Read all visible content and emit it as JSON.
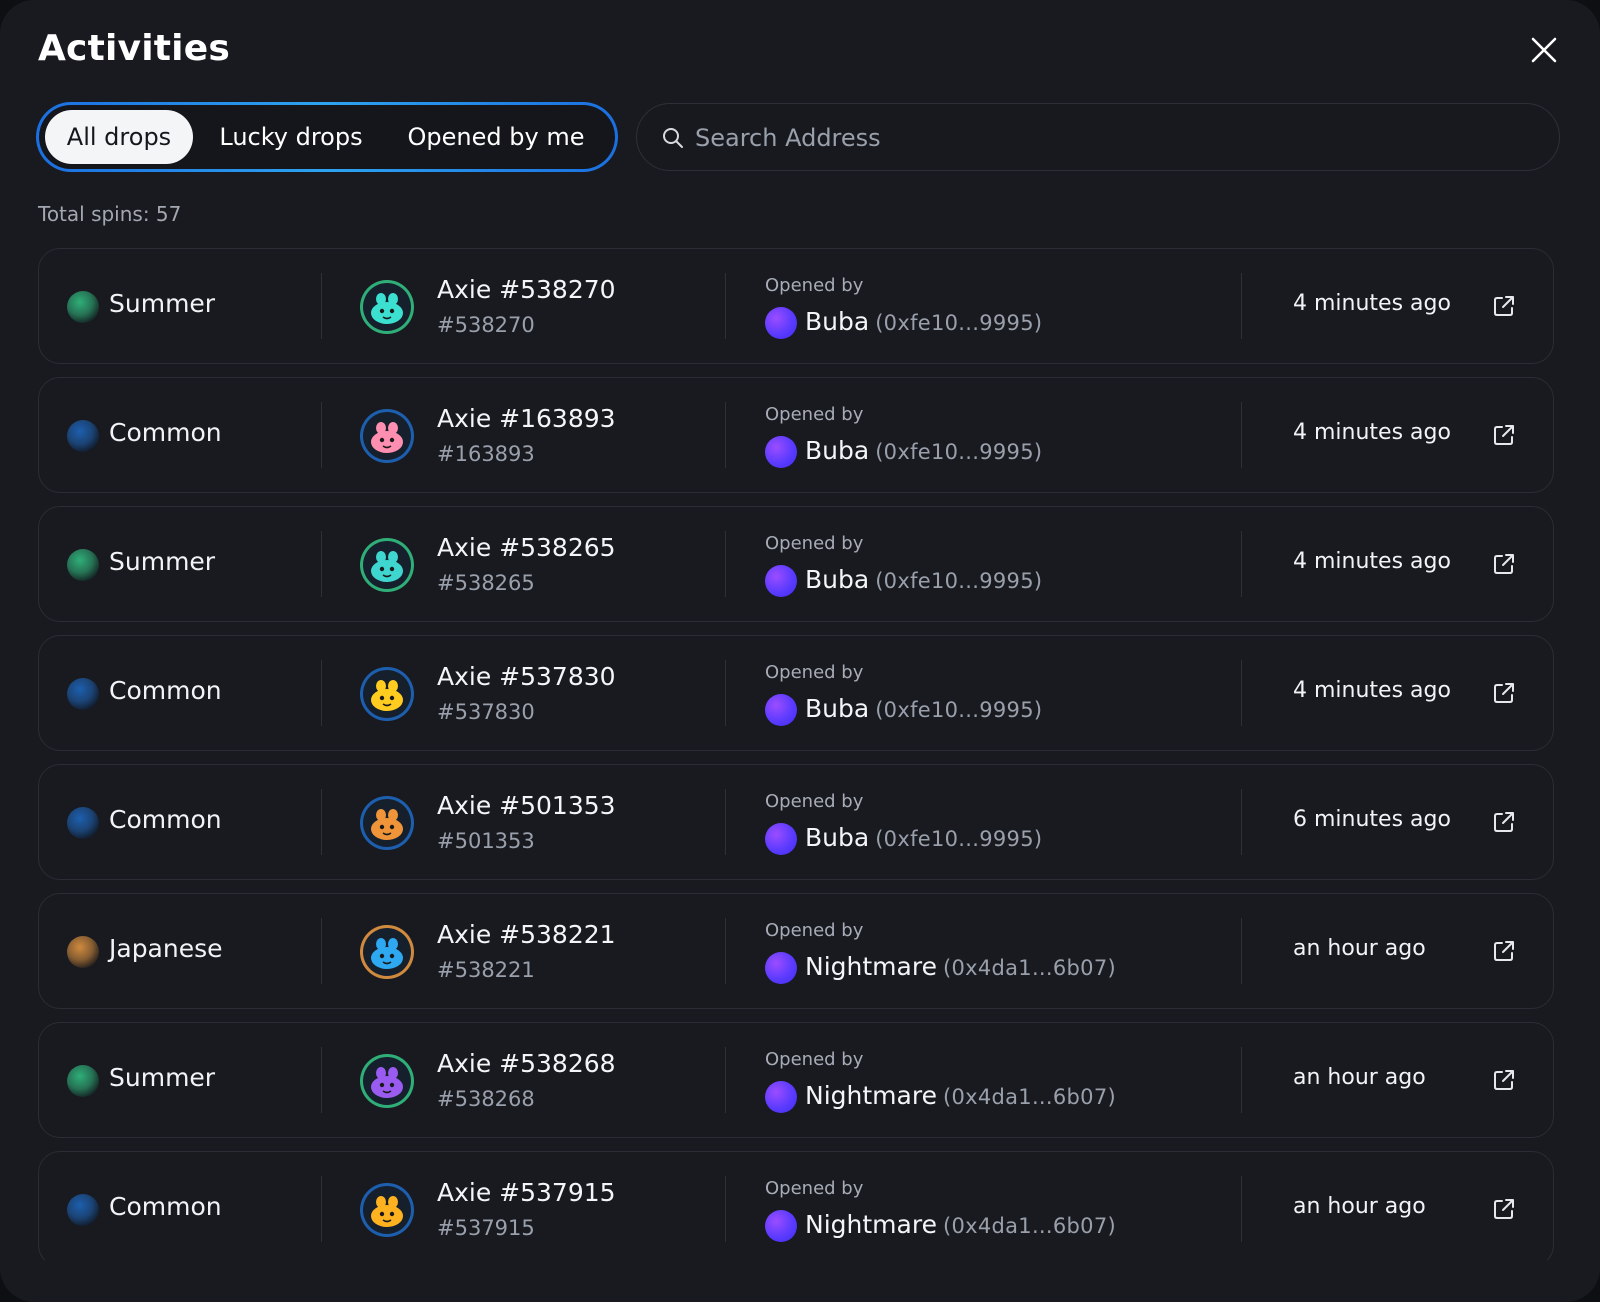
{
  "modal": {
    "title": "Activities",
    "tabs": [
      {
        "label": "All drops",
        "active": true
      },
      {
        "label": "Lucky drops",
        "active": false
      },
      {
        "label": "Opened by me",
        "active": false
      }
    ],
    "search_placeholder": "Search Address",
    "total_spins": "Total spins: 57",
    "opened_by_label": "Opened by"
  },
  "colors": {
    "summer": "#2fae78",
    "common": "#1d5fae",
    "japanese": "#d08a3e",
    "accent": "#2d8cf0",
    "user_avatar": "#6b3dff"
  },
  "rows": [
    {
      "tier": "Summer",
      "tier_color": "#2fae78",
      "axie": "Axie #538270",
      "id": "#538270",
      "user": "Buba",
      "addr": "(0xfe10...9995)",
      "time": "4 minutes ago",
      "axie_color": "#3ce0d0",
      "ring": "#2fae78"
    },
    {
      "tier": "Common",
      "tier_color": "#1d5fae",
      "axie": "Axie #163893",
      "id": "#163893",
      "user": "Buba",
      "addr": "(0xfe10...9995)",
      "time": "4 minutes ago",
      "axie_color": "#ff8fb0",
      "ring": "#1d5fae"
    },
    {
      "tier": "Summer",
      "tier_color": "#2fae78",
      "axie": "Axie #538265",
      "id": "#538265",
      "user": "Buba",
      "addr": "(0xfe10...9995)",
      "time": "4 minutes ago",
      "axie_color": "#3fd6d0",
      "ring": "#2fae78"
    },
    {
      "tier": "Common",
      "tier_color": "#1d5fae",
      "axie": "Axie #537830",
      "id": "#537830",
      "user": "Buba",
      "addr": "(0xfe10...9995)",
      "time": "4 minutes ago",
      "axie_color": "#ffcc1f",
      "ring": "#1d5fae"
    },
    {
      "tier": "Common",
      "tier_color": "#1d5fae",
      "axie": "Axie #501353",
      "id": "#501353",
      "user": "Buba",
      "addr": "(0xfe10...9995)",
      "time": "6 minutes ago",
      "axie_color": "#f0943a",
      "ring": "#1d5fae"
    },
    {
      "tier": "Japanese",
      "tier_color": "#d08a3e",
      "axie": "Axie #538221",
      "id": "#538221",
      "user": "Nightmare",
      "addr": "(0x4da1...6b07)",
      "time": "an hour ago",
      "axie_color": "#2ea8f0",
      "ring": "#d08a3e"
    },
    {
      "tier": "Summer",
      "tier_color": "#2fae78",
      "axie": "Axie #538268",
      "id": "#538268",
      "user": "Nightmare",
      "addr": "(0x4da1...6b07)",
      "time": "an hour ago",
      "axie_color": "#9a5cf0",
      "ring": "#2fae78"
    },
    {
      "tier": "Common",
      "tier_color": "#1d5fae",
      "axie": "Axie #537915",
      "id": "#537915",
      "user": "Nightmare",
      "addr": "(0x4da1...6b07)",
      "time": "an hour ago",
      "axie_color": "#ffb21f",
      "ring": "#1d5fae"
    }
  ]
}
